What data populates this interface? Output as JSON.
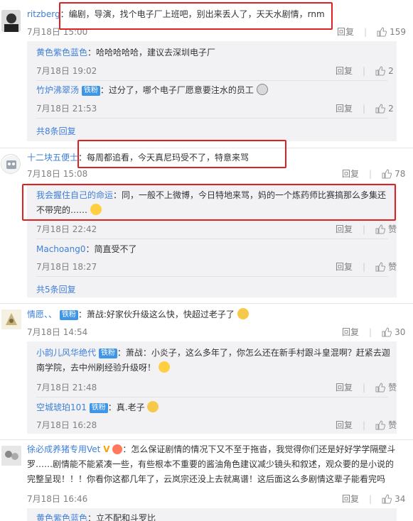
{
  "comments": [
    {
      "user": "ritzberg",
      "text": "编剧，导演，找个电子厂上班吧，别出来丢人了，天天水剧情，rnm",
      "time": "7月18日 15:00",
      "reply": "回复",
      "likes": "159",
      "subs": [
        {
          "user": "黄色紫色蓝色",
          "text": "哈哈哈哈哈，建议去深圳电子厂",
          "time": "7月18日 19:02",
          "reply": "回复",
          "likes": "2"
        },
        {
          "user": "竹炉沸翠汤",
          "badge": "铁粉",
          "text": "过分了，哪个电子厂愿意要注水的员工",
          "time": "7月18日 21:53",
          "reply": "回复",
          "likes": "2"
        }
      ],
      "more": "共8条回复"
    },
    {
      "user": "十二块五便士",
      "text": "每周都追看，今天真尼玛受不了，特意来骂",
      "time": "7月18日 15:08",
      "reply": "回复",
      "likes": "78",
      "subs": [
        {
          "user": "我会握住自己的命运",
          "text": "同，一般不上微博，今日特地来骂，妈的一个炼药师比赛搞那么多集还不带完的……",
          "time": "7月18日 22:42",
          "reply": "回复",
          "likes": "赞"
        },
        {
          "user": "Machoang0",
          "text": "简直受不了",
          "time": "7月18日 18:27",
          "reply": "回复",
          "likes": "赞"
        }
      ],
      "more": "共5条回复"
    },
    {
      "user": "情愿、、",
      "badge": "铁粉",
      "text": "萧战:好家伙升级这么快，快超过老子了",
      "time": "7月18日 14:54",
      "reply": "回复",
      "likes": "30",
      "subs": [
        {
          "user": "小韵儿风华绝代",
          "badge": "铁粉",
          "text": "萧战：小炎子，这么多年了，你怎么还在新手村跟斗皇混啊？赶紧去迦南学院，去中州刷经验升级呀！",
          "time": "7月18日 21:48",
          "reply": "回复",
          "likes": "赞"
        },
        {
          "user": "空城琥珀101",
          "badge": "铁粉",
          "text": "真.老子",
          "time": "7月18日 16:28",
          "reply": "回复",
          "likes": "赞"
        }
      ]
    },
    {
      "user": "徐必成养猪专用Vet",
      "text": "怎么保证剧情的情况下又不至于拖沓，我觉得你们还是好好学学隔壁斗罗……剧情能不能紧凑一些，有些根本不重要的酱油角色建议减少镜头和叙述，观众要的是小说的完整呈现！！！你看你这都几年了，云岚宗还没上去就离谱！这后面这么多剧情这辈子能看完吗",
      "time": "7月18日 16:46",
      "reply": "回复",
      "likes": "34",
      "subs": [
        {
          "user": "黄色紫色蓝色",
          "text": "立不配和斗罗比"
        }
      ]
    }
  ],
  "colors": {
    "link": "#eb7350",
    "highlight": "#e02020",
    "badge": "#3f96e6",
    "subbg": "#f2f2f5"
  }
}
